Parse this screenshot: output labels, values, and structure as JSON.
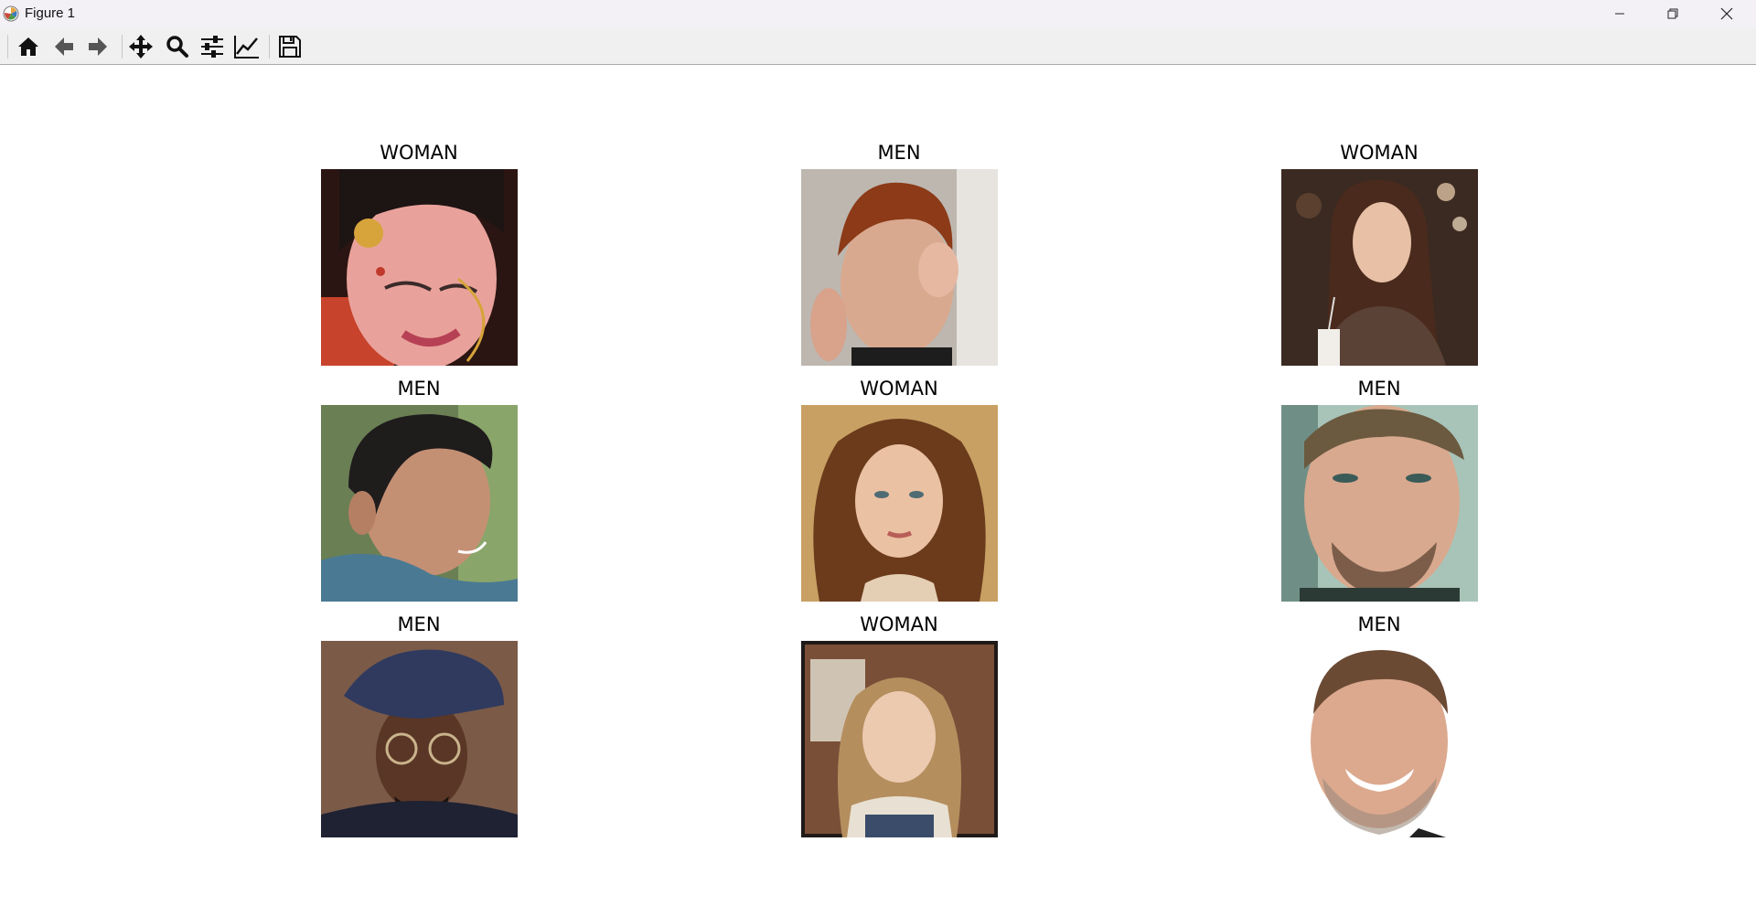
{
  "window": {
    "title": "Figure 1"
  },
  "toolbar": {
    "buttons": [
      {
        "name": "home-button",
        "icon": "home-icon"
      },
      {
        "name": "back-button",
        "icon": "arrow-left-icon"
      },
      {
        "name": "forward-button",
        "icon": "arrow-right-icon"
      },
      {
        "name": "pan-button",
        "icon": "move-icon"
      },
      {
        "name": "zoom-button",
        "icon": "search-icon"
      },
      {
        "name": "configure-subplots-button",
        "icon": "sliders-icon"
      },
      {
        "name": "edit-axis-button",
        "icon": "line-chart-icon"
      },
      {
        "name": "save-button",
        "icon": "floppy-disk-icon"
      }
    ]
  },
  "grid": {
    "cells": [
      {
        "label": "WOMAN",
        "image": "portrait-bride-jewelry"
      },
      {
        "label": "MEN",
        "image": "portrait-redhead-freckles"
      },
      {
        "label": "WOMAN",
        "image": "portrait-woman-cafe"
      },
      {
        "label": "MEN",
        "image": "portrait-young-man-profile"
      },
      {
        "label": "WOMAN",
        "image": "portrait-curly-hair-woman"
      },
      {
        "label": "MEN",
        "image": "portrait-man-stubble"
      },
      {
        "label": "MEN",
        "image": "portrait-man-beret-glasses"
      },
      {
        "label": "WOMAN",
        "image": "portrait-girl-car"
      },
      {
        "label": "MEN",
        "image": "portrait-smiling-man"
      }
    ]
  },
  "colors": {
    "titlebar": "#f3f0f6",
    "toolbar": "#f0f0f0",
    "figure_bg": "#ffffff"
  }
}
